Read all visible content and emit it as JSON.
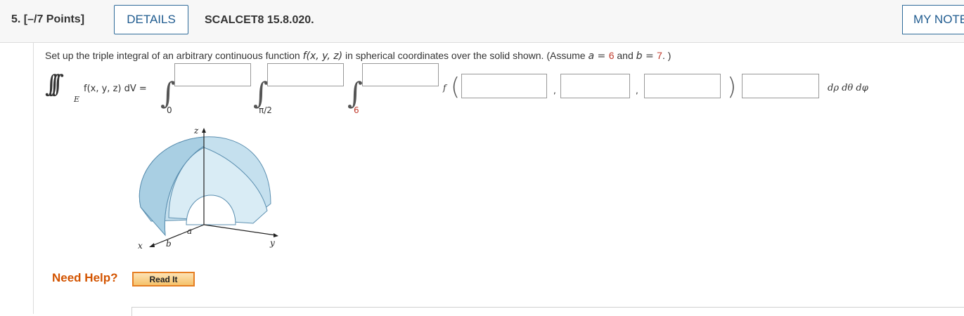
{
  "header": {
    "question_number": "5.  [–/7 Points]",
    "details_label": "DETAILS",
    "problem_code": "SCALCET8 15.8.020.",
    "my_notes_label": "MY NOTES"
  },
  "question": {
    "text_before": "Set up the triple integral of an arbitrary continuous function ",
    "function": "f(x, y, z)",
    "text_middle": " in spherical coordinates over the solid shown. (Assume ",
    "a_label": "a = ",
    "a_value": "6",
    "and_text": " and ",
    "b_label": "b = ",
    "b_value": "7",
    "text_end": ". )"
  },
  "integral": {
    "lhs": "f(x, y, z) dV =",
    "subscript_E": "E",
    "lower_limit_1": "0",
    "lower_limit_2": "π/2",
    "lower_limit_3": "6",
    "f_label": "f",
    "differentials": "dρ dθ dφ",
    "inputs": {
      "upper_limit_1": "",
      "upper_limit_2": "",
      "upper_limit_3": "",
      "arg_1": "",
      "arg_2": "",
      "arg_3": "",
      "factor": ""
    }
  },
  "figure": {
    "z_label": "z",
    "y_label": "y",
    "x_label": "x",
    "a_label": "a",
    "b_label": "b",
    "fill_color": "#c5e0ee",
    "edge_color": "#5b8fb0"
  },
  "help": {
    "need_help_label": "Need Help?",
    "read_it_label": "Read It"
  }
}
